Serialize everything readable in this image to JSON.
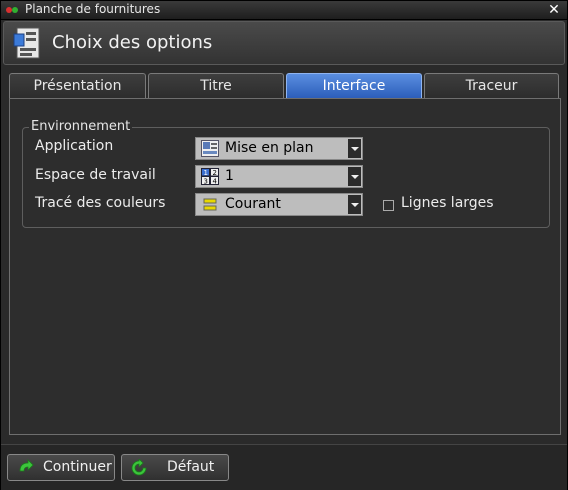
{
  "window": {
    "title": "Planche de fournitures",
    "close_glyph": "✕"
  },
  "header": {
    "title": "Choix des options",
    "icon": "options-document-icon"
  },
  "tabs": [
    {
      "label": "Présentation",
      "active": false
    },
    {
      "label": "Titre",
      "active": false
    },
    {
      "label": "Interface",
      "active": true
    },
    {
      "label": "Traceur",
      "active": false
    }
  ],
  "environment": {
    "group_label": "Environnement",
    "application": {
      "label": "Application",
      "value": "Mise en plan",
      "icon": "drawing-layout-icon"
    },
    "workspace": {
      "label": "Espace de travail",
      "value": "1",
      "icon": "workspace-grid-icon"
    },
    "color_plot": {
      "label": "Tracé des couleurs",
      "value": "Courant",
      "icon": "current-color-icon"
    },
    "wide_lines": {
      "label": "Lignes larges",
      "checked": false
    }
  },
  "footer": {
    "continue_label": "Continuer",
    "default_label": "Défaut"
  },
  "colors": {
    "active_tab": "#3a6fd0",
    "accent_green": "#3cc43c"
  }
}
